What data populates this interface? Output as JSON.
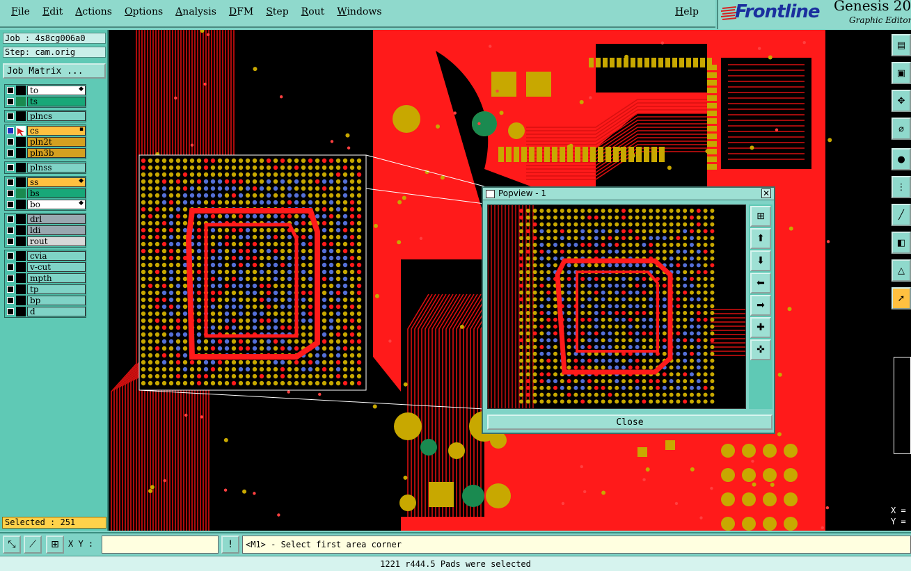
{
  "menu": {
    "items": [
      "File",
      "Edit",
      "Actions",
      "Options",
      "Analysis",
      "DFM",
      "Step",
      "Rout",
      "Windows"
    ],
    "help": "Help"
  },
  "brand": {
    "logo": "Frontline",
    "product": "Genesis 20",
    "subtitle": "Graphic Editor"
  },
  "job": {
    "job_label": "Job : 4s8cg006a0",
    "step_label": "Step: cam.orig",
    "matrix_button": "Job Matrix ..."
  },
  "layers": {
    "groups": [
      [
        {
          "name": "to",
          "color": "#ffffff",
          "mark": "◆"
        },
        {
          "name": "ts",
          "color": "#18a878",
          "mark": ""
        }
      ],
      [
        {
          "name": "plncs",
          "color": "#7fd3c6",
          "mark": ""
        }
      ],
      [
        {
          "name": "cs",
          "color": "#ffc040",
          "mark": "▪",
          "work": true
        },
        {
          "name": "pln2t",
          "color": "#d4a020",
          "mark": ""
        },
        {
          "name": "pln3b",
          "color": "#d4a020",
          "mark": ""
        }
      ],
      [
        {
          "name": "plnss",
          "color": "#7fd3c6",
          "mark": ""
        }
      ],
      [
        {
          "name": "ss",
          "color": "#ffc040",
          "mark": "◆"
        },
        {
          "name": "bs",
          "color": "#18a878",
          "mark": ""
        },
        {
          "name": "bo",
          "color": "#ffffff",
          "mark": "◆"
        }
      ],
      [
        {
          "name": "drl",
          "color": "#9aa8b0",
          "mark": ""
        },
        {
          "name": "ldi",
          "color": "#9aa8b0",
          "mark": ""
        },
        {
          "name": "rout",
          "color": "#d8d8d8",
          "mark": ""
        }
      ],
      [
        {
          "name": "cvia",
          "color": "#7fd3c6",
          "mark": ""
        },
        {
          "name": "v-cut",
          "color": "#7fd3c6",
          "mark": ""
        },
        {
          "name": "mpth",
          "color": "#7fd3c6",
          "mark": ""
        },
        {
          "name": "tp",
          "color": "#7fd3c6",
          "mark": ""
        },
        {
          "name": "bp",
          "color": "#7fd3c6",
          "mark": ""
        },
        {
          "name": "d",
          "color": "#7fd3c6",
          "mark": ""
        }
      ]
    ]
  },
  "selected_label": "Selected : 251",
  "popview": {
    "title": "Popview - 1",
    "close_button": "Close"
  },
  "toolbar": {
    "xy_label": "X Y :",
    "xy_value": "",
    "prompt": "<M1> - Select first area corner"
  },
  "status_line": "1221 r444.5 Pads were selected",
  "coords": {
    "x_label": "X =",
    "y_label": "Y ="
  },
  "colors": {
    "copper": "#ff1a1a",
    "pad": "#c8a800",
    "via_blue": "#5570d8",
    "board_bg": "#000000",
    "panel": "#5fc9b5"
  }
}
